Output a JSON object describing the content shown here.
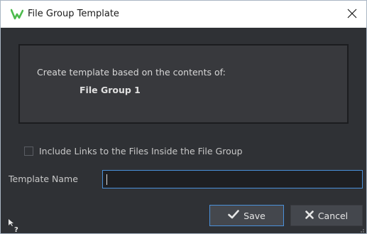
{
  "window": {
    "title": "File Group Template"
  },
  "info": {
    "line1": "Create template based on the contents of:",
    "group_name": "File Group 1"
  },
  "options": {
    "include_links_label": "Include Links to the Files Inside the File Group",
    "include_links_checked": false
  },
  "template_name": {
    "label": "Template Name",
    "value": ""
  },
  "buttons": {
    "save_label": "Save",
    "cancel_label": "Cancel"
  },
  "icons": {
    "app": "wavelab-logo-icon",
    "close": "close-icon",
    "save": "checkmark-icon",
    "cancel": "x-icon",
    "help": "help-cursor-icon",
    "resize": "resize-grip-icon"
  },
  "colors": {
    "background": "#2f3135",
    "accent": "#4a90d9",
    "logo_green": "#4dbb4d"
  }
}
